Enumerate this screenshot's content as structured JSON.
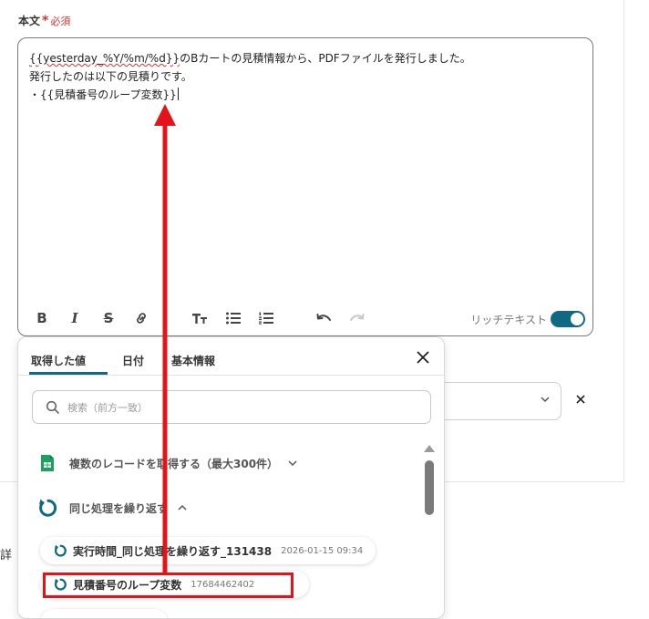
{
  "field": {
    "label": "本文",
    "required_star": "*",
    "required_text": "必須"
  },
  "editor": {
    "lines": [
      {
        "var": "{{yesterday_%Y/%m/%d}}",
        "text": "のBカートの見積情報から、PDFファイルを発行しました。"
      },
      {
        "text": "発行したのは以下の見積りです。"
      },
      {
        "text": "・{{見積番号のループ変数}}"
      }
    ],
    "toolbar": {
      "bold": "B",
      "italic": "I",
      "strike": "S",
      "rich_text_label": "リッチテキスト",
      "rich_text_enabled": true
    }
  },
  "popup": {
    "tabs": [
      "取得した値",
      "日付",
      "基本情報"
    ],
    "active_tab": 0,
    "search": {
      "placeholder": "検索（前方一致）",
      "value": ""
    },
    "groups": [
      {
        "label": "複数のレコードを取得する（最大300件）",
        "icon": "google-sheets-icon",
        "expanded": false
      },
      {
        "label": "同じ処理を繰り返す",
        "icon": "loop-icon",
        "expanded": true
      }
    ],
    "items": [
      {
        "name": "実行時間_同じ処理を繰り返す_131438",
        "value": "2026-01-15 09:34"
      },
      {
        "name": "見積番号のループ変数",
        "value": "17684462402"
      }
    ]
  },
  "colors": {
    "accent": "#0d6a82",
    "required": "#e0312b",
    "annotation": "#e2141a",
    "sheets_green": "#1aa260"
  }
}
